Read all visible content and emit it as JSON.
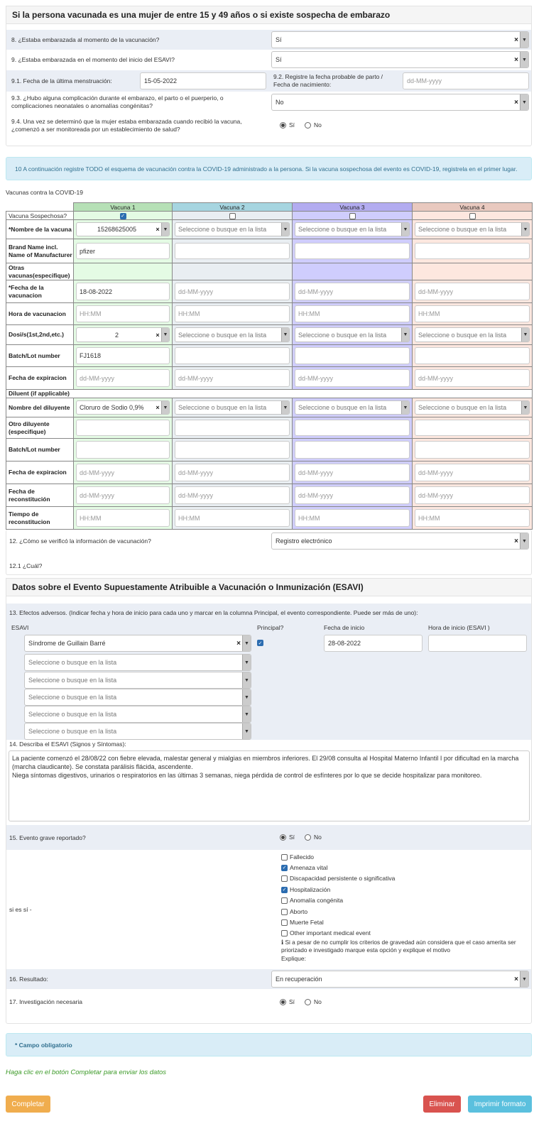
{
  "pregnancy": {
    "title": "Si la persona vacunada es una mujer de entre 15 y 49 años o si existe sospecha de embarazo",
    "q8_label": "8. ¿Estaba embarazada al momento de la vacunación?",
    "q8_value": "Sí",
    "q9_label": "9. ¿Estaba embarazada en el momento del inicio del ESAVI?",
    "q9_value": "Sí",
    "q91_label": "9.1. Fecha de la última menstruación:",
    "q91_value": "15-05-2022",
    "q92_label": "9.2. Registre la fecha probable de parto / Fecha de nacimiento:",
    "q92_placeholder": "dd-MM-yyyy",
    "q93_label": "9.3. ¿Hubo alguna complicación durante el embarazo, el parto o el puerperio, o complicaciones neonatales o anomalías congénitas?",
    "q93_value": "No",
    "q94_label": "9.4. Una vez se determinó que la mujer estaba embarazada cuando recibió la vacuna, ¿comenzó a ser monitoreada por un establecimiento de salud?",
    "yes": "Sí",
    "no": "No"
  },
  "vaccination": {
    "info": "10 A continuación registre TODO el esquema de vacunación contra la COVID-19 administrado a la persona. Si la vacuna sospechosa del evento es COVID-19, registrela en el primer lugar.",
    "table_title": "Vacunas contra la COVID-19",
    "columns": [
      "Vacuna 1",
      "Vacuna 2",
      "Vacuna 3",
      "Vacuna 4"
    ],
    "rows": {
      "suspect": "Vacuna Sospechosa?",
      "name": "*Nombre de la vacuna",
      "brand": "Brand Name incl. Name of Manufacturer",
      "other": "Otras vacunas(especifique)",
      "date": "*Fecha de la vacunacion",
      "hour": "Hora de vacunacion",
      "dose": "Dosi/s(1st,2nd,etc.)",
      "batch": "Batch/Lot number",
      "expiry": "Fecha de expiracion",
      "diluent": "Diluent (if applicable)",
      "dil_name": "Nombre del diluyente",
      "dil_other": "Otro diluyente (especifique)",
      "dil_batch": "Batch/Lot number",
      "dil_expiry": "Fecha de expiracion",
      "recon_date": "Fecha de reconstitución",
      "recon_time": "Tiempo de reconstitucion"
    },
    "v1": {
      "name": "15268625005",
      "brand": "pfizer",
      "date": "18-08-2022",
      "dose": "2",
      "batch": "FJ1618",
      "dil_name": "Cloruro de Sodio 0,9%"
    },
    "select_placeholder": "Seleccione o busque en la lista",
    "date_placeholder": "dd-MM-yyyy",
    "time_placeholder": "HH:MM",
    "q12_label": "12. ¿Cómo se verificó la información de vacunación?",
    "q12_value": "Registro electrónico",
    "q121_label": "12.1 ¿Cuál?"
  },
  "esavi": {
    "title": "Datos sobre el Evento Supuestamente Atribuible a Vacunación o Inmunización (ESAVI)",
    "q13_label": "13. Efectos adversos. (Indicar fecha y hora de inicio para cada uno y marcar en la columna Principal, el evento correspondiente. Puede ser más de uno):",
    "col_esavi": "ESAVI",
    "col_principal": "Principal?",
    "col_fecha": "Fecha de inicio",
    "col_hora": "Hora de inicio (ESAVI )",
    "event1": "Síndrome de Guillain Barré",
    "event1_date": "28-08-2022",
    "placeholder": "Seleccione o busque en la lista",
    "q14_label": "14. Describa el ESAVI (Signos y Síntomas):",
    "q14_text": "La paciente comenzó el 28/08/22 con fiebre elevada, malestar general y mialgias en miembros inferiores. El 29/08 consulta al Hospital Materno Infantil I por dificultad en la marcha (marcha claudicante). Se constata parálisis flácida, ascendente.\nNiega síntomas digestivos, urinarios o respiratorios en las últimas 3 semanas, niega pérdida de control de esfínteres por lo que se decide hospitalizar para monitoreo.",
    "q15_label": "15. Evento grave reportado?",
    "si_es_si": "si es sí -",
    "grave_options": [
      "Fallecido",
      "Amenaza vital",
      "Discapacidad persistente o significativa",
      "Hospitalización",
      "Anomalía congénita",
      "Aborto",
      "Muerte Fetal",
      "Other important medical event"
    ],
    "grave_checked": [
      false,
      true,
      false,
      true,
      false,
      false,
      false,
      false
    ],
    "grave_note": "Si a pesar de no cumplir los criterios de gravedad aún considera que el caso amerita ser priorizado e investigado marque esta opción y explique el motivo",
    "explique": "Explique:",
    "q16_label": "16. Resultado:",
    "q16_value": "En recuperación",
    "q17_label": "17. Investigación necesaria",
    "yes": "Sí",
    "no": "No"
  },
  "footer": {
    "required": "* Campo obligatorio",
    "hint": "Haga clic en el botón Completar para enviar los datos",
    "complete": "Completar",
    "delete": "Eliminar",
    "print": "Imprimir formato"
  }
}
